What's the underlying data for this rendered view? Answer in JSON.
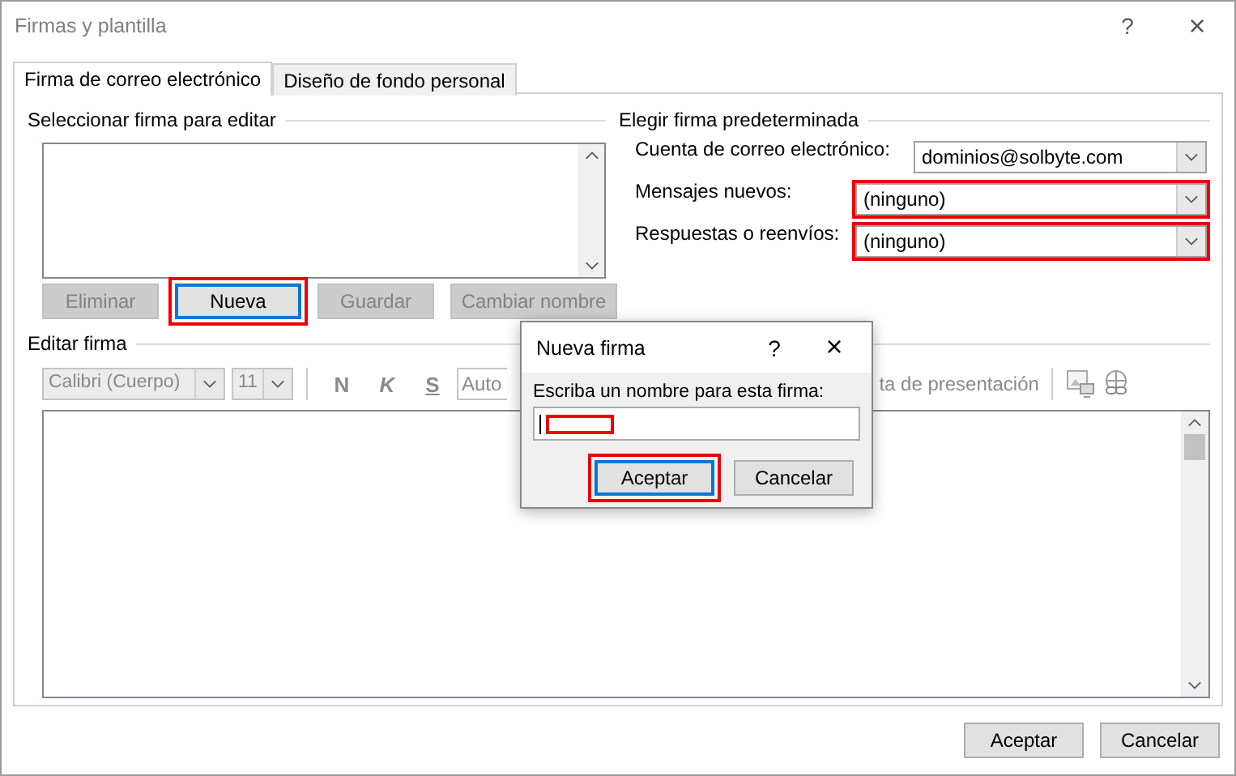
{
  "window": {
    "title": "Firmas y plantilla",
    "help": "?",
    "close": "×"
  },
  "tabs": [
    {
      "label": "Firma de correo electrónico",
      "selected": true
    },
    {
      "label": "Diseño de fondo personal",
      "selected": false
    }
  ],
  "select_signature": {
    "heading": "Seleccionar firma para editar",
    "buttons": [
      {
        "label": "Eliminar",
        "disabled": true,
        "focused": false,
        "highlighted": false
      },
      {
        "label": "Nueva",
        "disabled": false,
        "focused": true,
        "highlighted": true
      },
      {
        "label": "Guardar",
        "disabled": true,
        "focused": false,
        "highlighted": false
      },
      {
        "label": "Cambiar nombre",
        "disabled": true,
        "focused": false,
        "highlighted": false
      }
    ]
  },
  "default_signature": {
    "heading": "Elegir firma predeterminada",
    "fields": [
      {
        "label": "Cuenta de correo electrónico:",
        "value": "dominios@solbyte.com",
        "highlighted": false
      },
      {
        "label": "Mensajes nuevos:",
        "value": "(ninguno)",
        "highlighted": true
      },
      {
        "label": "Respuestas o reenvíos:",
        "value": "(ninguno)",
        "highlighted": true
      }
    ]
  },
  "edit_signature": {
    "heading": "Editar firma",
    "disabled": true,
    "font": "Calibri (Cuerpo)",
    "size": "11",
    "format_buttons": [
      {
        "label": "N",
        "kind": "bold"
      },
      {
        "label": "K",
        "kind": "italic"
      },
      {
        "label": "S",
        "kind": "underline"
      }
    ],
    "color_field": "Auto",
    "business_card": "ta de presentación"
  },
  "buttons": [
    {
      "label": "Aceptar"
    },
    {
      "label": "Cancelar"
    }
  ],
  "new_signature_dialog": {
    "title": "Nueva firma",
    "help": "?",
    "close": "×",
    "prompt": "Escriba un nombre para esta firma:",
    "value_highlighted": true,
    "buttons": [
      {
        "label": "Aceptar",
        "focused": true,
        "highlighted": true
      },
      {
        "label": "Cancelar",
        "focused": false,
        "highlighted": false
      }
    ]
  }
}
